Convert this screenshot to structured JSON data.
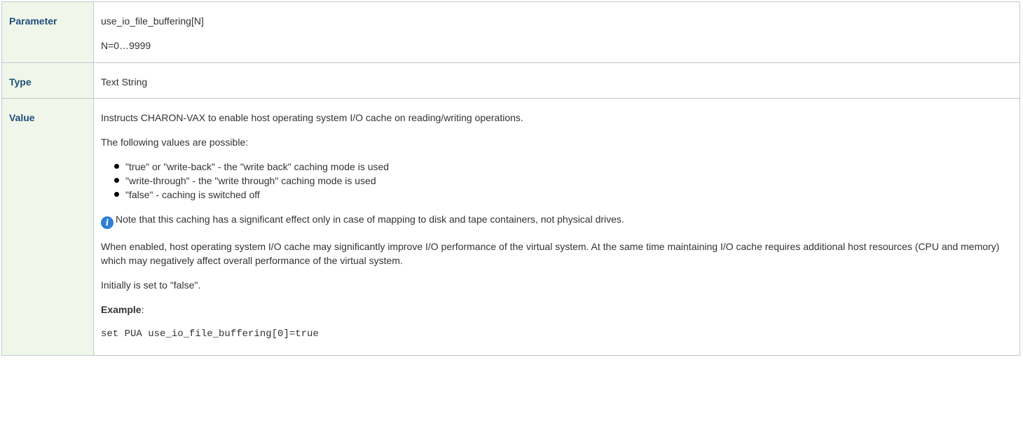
{
  "rows": {
    "parameter": {
      "label": "Parameter",
      "name": "use_io_file_buffering[N]",
      "range": "N=0…9999"
    },
    "type": {
      "label": "Type",
      "value": "Text String"
    },
    "value": {
      "label": "Value",
      "intro": "Instructs CHARON-VAX to enable host operating system I/O cache on reading/writing operations.",
      "possible_intro": "The following values are possible:",
      "options": [
        "\"true\" or \"write-back\" - the \"write back\" caching mode is used",
        "\"write-through\" - the \"write through\" caching mode is used",
        "\"false\" - caching is switched off"
      ],
      "note_icon": "info-icon",
      "note": "Note that this caching has a significant effect only in case of mapping to disk and tape containers, not physical drives.",
      "enabled_text": "When enabled, host operating system I/O cache may significantly improve I/O performance of the virtual system. At the same time maintaining I/O cache requires additional host resources (CPU and memory) which may negatively affect overall performance of the virtual system.",
      "initial_text": "Initially is set to \"false\".",
      "example_label": "Example",
      "example_colon": ":",
      "example_code": "set PUA use_io_file_buffering[0]=true"
    }
  },
  "colors": {
    "header_bg": "#f0f7ea",
    "header_text": "#1f4e79",
    "border": "#c1c7d0",
    "info_icon": "#2f7fd6"
  }
}
